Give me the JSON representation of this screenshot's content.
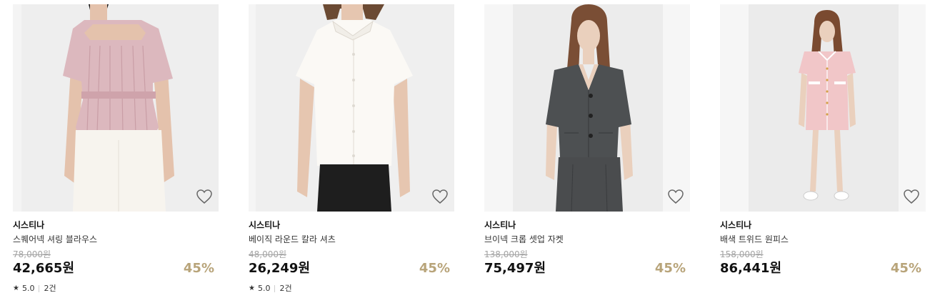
{
  "products": [
    {
      "brand": "시스티나",
      "name": "스퀘어넥 셔링 블라우스",
      "original_price": "78,000원",
      "price": "42,665원",
      "discount": "45%",
      "rating": "5.0",
      "review_count": "2건",
      "star_glyph": "★",
      "image_icon": "model-pink-blouse"
    },
    {
      "brand": "시스티나",
      "name": "베이직 라운드 칼라 셔츠",
      "original_price": "48,000원",
      "price": "26,249원",
      "discount": "45%",
      "rating": "5.0",
      "review_count": "2건",
      "star_glyph": "★",
      "image_icon": "model-white-shirt"
    },
    {
      "brand": "시스티나",
      "name": "브이넥 크롭 셋업 자켓",
      "original_price": "138,000원",
      "price": "75,497원",
      "discount": "45%",
      "image_icon": "model-gray-jacket"
    },
    {
      "brand": "시스티나",
      "name": "배색 트위드 원피스",
      "original_price": "158,000원",
      "price": "86,441원",
      "discount": "45%",
      "image_icon": "model-pink-tweed-dress"
    }
  ],
  "colors": {
    "discount": "#b8a47a",
    "original_price": "#a3a3a3"
  }
}
